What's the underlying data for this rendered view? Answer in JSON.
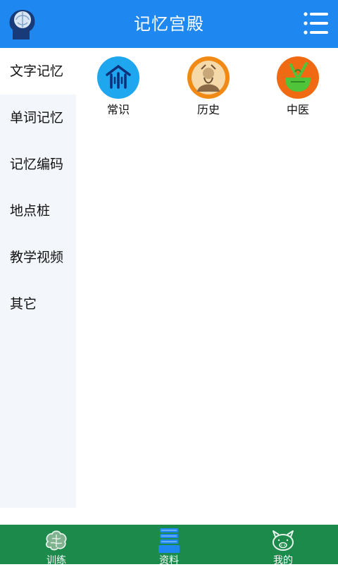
{
  "header": {
    "title": "记忆宫殿",
    "background_color": "#1e88f0",
    "logo_icon": "brain-head-icon",
    "menu_icon": "list-menu-icon"
  },
  "sidebar": {
    "items": [
      {
        "label": "文字记忆",
        "active": true
      },
      {
        "label": "单词记忆",
        "active": false
      },
      {
        "label": "记忆编码",
        "active": false
      },
      {
        "label": "地点桩",
        "active": false
      },
      {
        "label": "教学视频",
        "active": false
      },
      {
        "label": "其它",
        "active": false
      }
    ]
  },
  "categories": [
    {
      "label": "常识",
      "icon": "common-sense-icon",
      "color": "#1ea6ee"
    },
    {
      "label": "历史",
      "icon": "history-icon",
      "color": "#f08a14"
    },
    {
      "label": "中医",
      "icon": "chinese-medicine-icon",
      "color": "#f06a14"
    }
  ],
  "tabbar": {
    "background_color": "#1b8a4a",
    "tabs": [
      {
        "label": "训练",
        "icon": "brain-icon",
        "active": false
      },
      {
        "label": "资料",
        "icon": "books-icon",
        "active": true
      },
      {
        "label": "我的",
        "icon": "pig-icon",
        "active": false
      }
    ]
  }
}
